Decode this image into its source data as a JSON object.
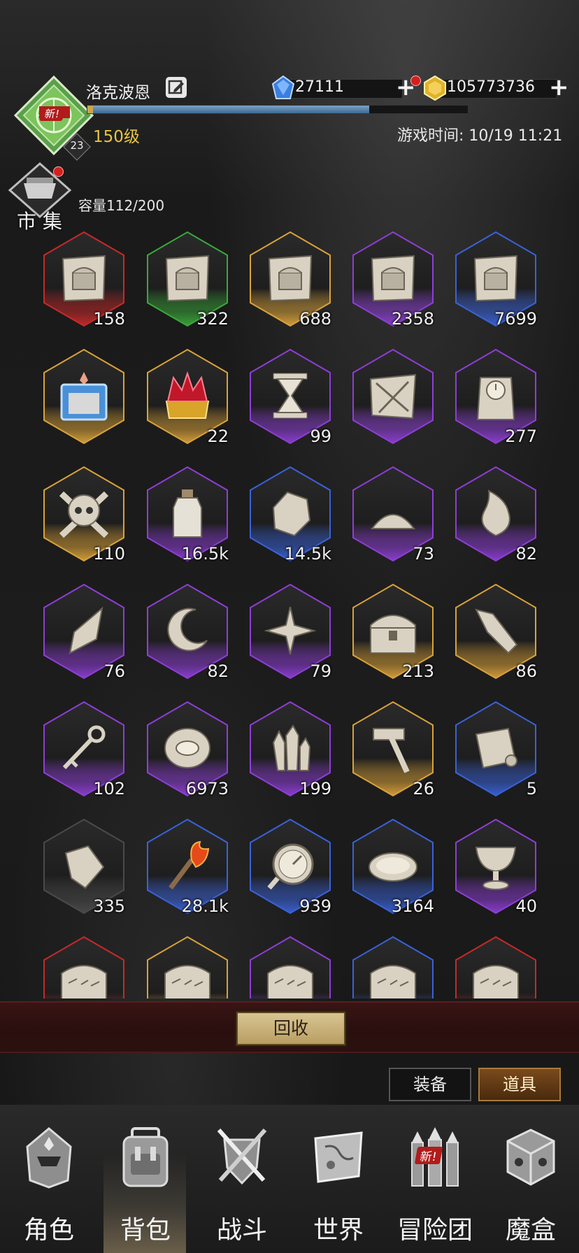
{
  "header": {
    "player_name": "洛克波恩",
    "level_text": "150级",
    "level_badge": "23",
    "avatar_tag": "新!",
    "game_time": "游戏时间: 10/19 11:21",
    "xp_fraction": 0.74,
    "gems": "27111",
    "gold": "105773736"
  },
  "market": {
    "label": "市 集",
    "capacity": "容量112/200"
  },
  "items": [
    {
      "icon": "chest-map-icon",
      "count": "158",
      "rarity": "red"
    },
    {
      "icon": "chest-map-icon",
      "count": "322",
      "rarity": "green"
    },
    {
      "icon": "chest-map-icon",
      "count": "688",
      "rarity": "gold"
    },
    {
      "icon": "chest-map-icon",
      "count": "2358",
      "rarity": "purple"
    },
    {
      "icon": "chest-map-icon",
      "count": "7699",
      "rarity": "blue"
    },
    {
      "icon": "blue-dice-box-icon",
      "count": "",
      "rarity": "gold"
    },
    {
      "icon": "red-crown-icon",
      "count": "22",
      "rarity": "gold"
    },
    {
      "icon": "hourglass-icon",
      "count": "99",
      "rarity": "purple"
    },
    {
      "icon": "torn-scroll-icon",
      "count": "",
      "rarity": "purple"
    },
    {
      "icon": "clock-icon",
      "count": "277",
      "rarity": "purple"
    },
    {
      "icon": "skull-icon",
      "count": "110",
      "rarity": "gold"
    },
    {
      "icon": "bottle-icon",
      "count": "16.5k",
      "rarity": "purple"
    },
    {
      "icon": "rock-icon",
      "count": "14.5k",
      "rarity": "blue"
    },
    {
      "icon": "dust-pile-icon",
      "count": "73",
      "rarity": "purple"
    },
    {
      "icon": "flame-wisp-icon",
      "count": "82",
      "rarity": "purple"
    },
    {
      "icon": "shard-icon",
      "count": "76",
      "rarity": "purple"
    },
    {
      "icon": "crescent-icon",
      "count": "82",
      "rarity": "purple"
    },
    {
      "icon": "spark-icon",
      "count": "79",
      "rarity": "purple"
    },
    {
      "icon": "treasure-chest-icon",
      "count": "213",
      "rarity": "gold"
    },
    {
      "icon": "crystal-shard-icon",
      "count": "86",
      "rarity": "gold"
    },
    {
      "icon": "key-icon",
      "count": "102",
      "rarity": "purple"
    },
    {
      "icon": "eye-stone-icon",
      "count": "6973",
      "rarity": "purple"
    },
    {
      "icon": "crystals-icon",
      "count": "199",
      "rarity": "purple"
    },
    {
      "icon": "hammer-icon",
      "count": "26",
      "rarity": "gold"
    },
    {
      "icon": "scroll-icon",
      "count": "5",
      "rarity": "blue"
    },
    {
      "icon": "fragment-icon",
      "count": "335",
      "rarity": "gray"
    },
    {
      "icon": "torch-icon",
      "count": "28.1k",
      "rarity": "blue"
    },
    {
      "icon": "compass-icon",
      "count": "939",
      "rarity": "blue"
    },
    {
      "icon": "plate-icon",
      "count": "3164",
      "rarity": "blue"
    },
    {
      "icon": "goblet-icon",
      "count": "40",
      "rarity": "purple"
    },
    {
      "icon": "rune-tablet-icon",
      "count": "",
      "rarity": "red"
    },
    {
      "icon": "rune-tablet-icon",
      "count": "",
      "rarity": "gold"
    },
    {
      "icon": "rune-tablet-icon",
      "count": "",
      "rarity": "purple"
    },
    {
      "icon": "rune-tablet-icon",
      "count": "",
      "rarity": "blue"
    },
    {
      "icon": "rune-tablet-icon",
      "count": "",
      "rarity": "red"
    }
  ],
  "recycle_label": "回收",
  "tabs": {
    "equip": "装备",
    "items": "道具",
    "selected": "道具"
  },
  "nav": [
    {
      "label": "角色",
      "icon": "helmet-icon"
    },
    {
      "label": "背包",
      "icon": "backpack-icon",
      "selected": true
    },
    {
      "label": "战斗",
      "icon": "swords-shield-icon"
    },
    {
      "label": "世界",
      "icon": "map-icon"
    },
    {
      "label": "冒险团",
      "icon": "towers-icon",
      "tag": "新!"
    },
    {
      "label": "魔盒",
      "icon": "cube-icon"
    }
  ],
  "rarity_colors": {
    "red": "#c62a2a",
    "green": "#3aa83a",
    "gold": "#d9a23a",
    "purple": "#8e3ed6",
    "blue": "#3a62d8",
    "gray": "#4a4a4a"
  }
}
